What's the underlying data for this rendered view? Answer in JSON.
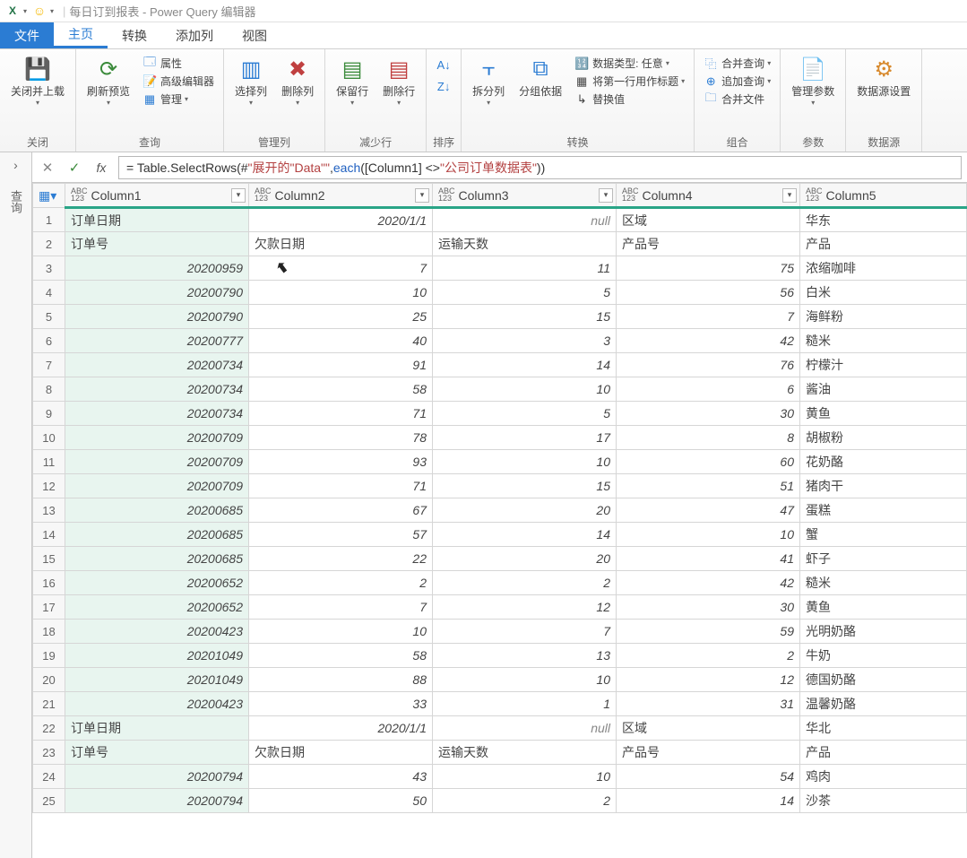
{
  "title": {
    "doc": "每日订到报表",
    "app": "Power Query 编辑器"
  },
  "ribbon_tabs": {
    "file": "文件",
    "home": "主页",
    "transform": "转换",
    "addcol": "添加列",
    "view": "视图"
  },
  "ribbon": {
    "close_group": "关闭",
    "close_upload": "关闭并上载",
    "query_group": "查询",
    "refresh": "刷新预览",
    "props": "属性",
    "adveditor": "高级编辑器",
    "manage": "管理",
    "mgcols_group": "管理列",
    "choose_col": "选择列",
    "remove_col": "删除列",
    "rows_group": "减少行",
    "keep_rows": "保留行",
    "remove_rows": "删除行",
    "sort_group": "排序",
    "split_group": "",
    "split_col": "拆分列",
    "groupby": "分组依据",
    "trans_group": "转换",
    "dtype": "数据类型: 任意",
    "firstrow_header": "将第一行用作标题",
    "replace": "替换值",
    "combine_group": "组合",
    "merge_q": "合并查询",
    "append_q": "追加查询",
    "combine_files": "合并文件",
    "params_group": "参数",
    "manage_params": "管理参数",
    "ds_group": "数据源",
    "ds_settings": "数据源设置"
  },
  "formula": {
    "p1": "= Table.SelectRows(#",
    "s1": "\"展开的\"Data\"\"",
    "p2": ", ",
    "kw": "each",
    "p3": " ([Column1] <> ",
    "s2": "\"公司订单数据表\"",
    "p4": "))"
  },
  "side_panel": "查询",
  "columns": [
    "Column1",
    "Column2",
    "Column3",
    "Column4",
    "Column5"
  ],
  "rows": [
    {
      "n": 1,
      "c1": "订单日期",
      "c2": "2020/1/1",
      "c3": "null",
      "c4": "区域",
      "c5": "华东",
      "t": [
        "text",
        "num",
        "null",
        "text",
        "text"
      ]
    },
    {
      "n": 2,
      "c1": "订单号",
      "c2": "欠款日期",
      "c3": "运输天数",
      "c4": "产品号",
      "c5": "产品",
      "t": [
        "text",
        "text",
        "text",
        "text",
        "text"
      ]
    },
    {
      "n": 3,
      "c1": "20200959",
      "c2": "7",
      "c3": "11",
      "c4": "75",
      "c5": "浓缩咖啡",
      "t": [
        "num",
        "num",
        "num",
        "num",
        "text"
      ],
      "cursor": true
    },
    {
      "n": 4,
      "c1": "20200790",
      "c2": "10",
      "c3": "5",
      "c4": "56",
      "c5": "白米",
      "t": [
        "num",
        "num",
        "num",
        "num",
        "text"
      ]
    },
    {
      "n": 5,
      "c1": "20200790",
      "c2": "25",
      "c3": "15",
      "c4": "7",
      "c5": "海鲜粉",
      "t": [
        "num",
        "num",
        "num",
        "num",
        "text"
      ]
    },
    {
      "n": 6,
      "c1": "20200777",
      "c2": "40",
      "c3": "3",
      "c4": "42",
      "c5": "糙米",
      "t": [
        "num",
        "num",
        "num",
        "num",
        "text"
      ]
    },
    {
      "n": 7,
      "c1": "20200734",
      "c2": "91",
      "c3": "14",
      "c4": "76",
      "c5": "柠檬汁",
      "t": [
        "num",
        "num",
        "num",
        "num",
        "text"
      ]
    },
    {
      "n": 8,
      "c1": "20200734",
      "c2": "58",
      "c3": "10",
      "c4": "6",
      "c5": "酱油",
      "t": [
        "num",
        "num",
        "num",
        "num",
        "text"
      ]
    },
    {
      "n": 9,
      "c1": "20200734",
      "c2": "71",
      "c3": "5",
      "c4": "30",
      "c5": "黄鱼",
      "t": [
        "num",
        "num",
        "num",
        "num",
        "text"
      ]
    },
    {
      "n": 10,
      "c1": "20200709",
      "c2": "78",
      "c3": "17",
      "c4": "8",
      "c5": "胡椒粉",
      "t": [
        "num",
        "num",
        "num",
        "num",
        "text"
      ]
    },
    {
      "n": 11,
      "c1": "20200709",
      "c2": "93",
      "c3": "10",
      "c4": "60",
      "c5": "花奶酪",
      "t": [
        "num",
        "num",
        "num",
        "num",
        "text"
      ]
    },
    {
      "n": 12,
      "c1": "20200709",
      "c2": "71",
      "c3": "15",
      "c4": "51",
      "c5": "猪肉干",
      "t": [
        "num",
        "num",
        "num",
        "num",
        "text"
      ]
    },
    {
      "n": 13,
      "c1": "20200685",
      "c2": "67",
      "c3": "20",
      "c4": "47",
      "c5": "蛋糕",
      "t": [
        "num",
        "num",
        "num",
        "num",
        "text"
      ]
    },
    {
      "n": 14,
      "c1": "20200685",
      "c2": "57",
      "c3": "14",
      "c4": "10",
      "c5": "蟹",
      "t": [
        "num",
        "num",
        "num",
        "num",
        "text"
      ]
    },
    {
      "n": 15,
      "c1": "20200685",
      "c2": "22",
      "c3": "20",
      "c4": "41",
      "c5": "虾子",
      "t": [
        "num",
        "num",
        "num",
        "num",
        "text"
      ]
    },
    {
      "n": 16,
      "c1": "20200652",
      "c2": "2",
      "c3": "2",
      "c4": "42",
      "c5": "糙米",
      "t": [
        "num",
        "num",
        "num",
        "num",
        "text"
      ]
    },
    {
      "n": 17,
      "c1": "20200652",
      "c2": "7",
      "c3": "12",
      "c4": "30",
      "c5": "黄鱼",
      "t": [
        "num",
        "num",
        "num",
        "num",
        "text"
      ]
    },
    {
      "n": 18,
      "c1": "20200423",
      "c2": "10",
      "c3": "7",
      "c4": "59",
      "c5": "光明奶酪",
      "t": [
        "num",
        "num",
        "num",
        "num",
        "text"
      ]
    },
    {
      "n": 19,
      "c1": "20201049",
      "c2": "58",
      "c3": "13",
      "c4": "2",
      "c5": "牛奶",
      "t": [
        "num",
        "num",
        "num",
        "num",
        "text"
      ]
    },
    {
      "n": 20,
      "c1": "20201049",
      "c2": "88",
      "c3": "10",
      "c4": "12",
      "c5": "德国奶酪",
      "t": [
        "num",
        "num",
        "num",
        "num",
        "text"
      ]
    },
    {
      "n": 21,
      "c1": "20200423",
      "c2": "33",
      "c3": "1",
      "c4": "31",
      "c5": "温馨奶酪",
      "t": [
        "num",
        "num",
        "num",
        "num",
        "text"
      ]
    },
    {
      "n": 22,
      "c1": "订单日期",
      "c2": "2020/1/1",
      "c3": "null",
      "c4": "区域",
      "c5": "华北",
      "t": [
        "text",
        "num",
        "null",
        "text",
        "text"
      ]
    },
    {
      "n": 23,
      "c1": "订单号",
      "c2": "欠款日期",
      "c3": "运输天数",
      "c4": "产品号",
      "c5": "产品",
      "t": [
        "text",
        "text",
        "text",
        "text",
        "text"
      ]
    },
    {
      "n": 24,
      "c1": "20200794",
      "c2": "43",
      "c3": "10",
      "c4": "54",
      "c5": "鸡肉",
      "t": [
        "num",
        "num",
        "num",
        "num",
        "text"
      ]
    },
    {
      "n": 25,
      "c1": "20200794",
      "c2": "50",
      "c3": "2",
      "c4": "14",
      "c5": "沙茶",
      "t": [
        "num",
        "num",
        "num",
        "num",
        "text"
      ]
    }
  ]
}
